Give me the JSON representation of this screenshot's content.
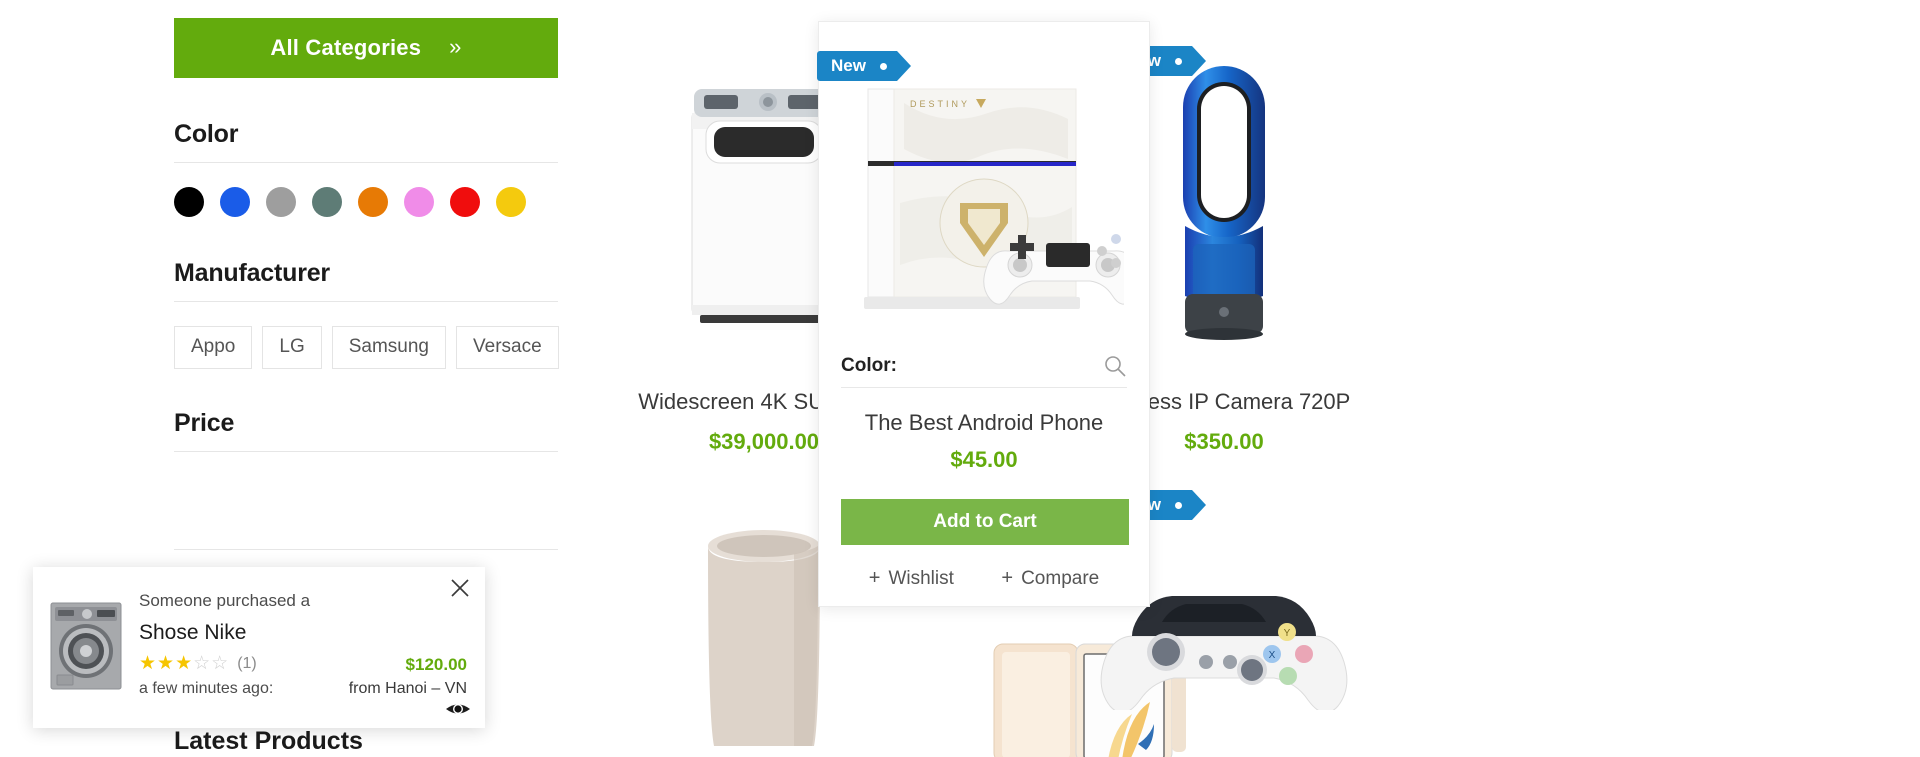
{
  "sidebar": {
    "all_categories": {
      "label": "All Categories",
      "chevron": "»",
      "bg": "#63ab0d"
    },
    "color_facet": {
      "title": "Color",
      "swatches": [
        {
          "name": "black",
          "hex": "#000000"
        },
        {
          "name": "blue",
          "hex": "#1a5ce8"
        },
        {
          "name": "grey",
          "hex": "#9e9e9e"
        },
        {
          "name": "slate",
          "hex": "#5e7c76"
        },
        {
          "name": "orange",
          "hex": "#e77a05"
        },
        {
          "name": "pink",
          "hex": "#f08ce8"
        },
        {
          "name": "red",
          "hex": "#f00d0d"
        },
        {
          "name": "yellow",
          "hex": "#f4ca0e"
        }
      ]
    },
    "manufacturer_facet": {
      "title": "Manufacturer",
      "items": [
        "Appo",
        "LG",
        "Samsung",
        "Versace"
      ]
    },
    "price_facet": {
      "title": "Price"
    },
    "latest_products_title": "Latest Products"
  },
  "products": [
    {
      "name": "Widescreen 4K SUHD TV",
      "price": "$39,000.00",
      "badge": null,
      "image": "washing-machine"
    },
    {
      "name": "The Best Android Phone",
      "price": "$45.00",
      "badge": "New",
      "image": "game-console"
    },
    {
      "name": "Wireless IP Camera 720P",
      "price": "$350.00",
      "badge": "New",
      "image": "air-purifier-fan"
    },
    {
      "name": "",
      "price": "",
      "badge": null,
      "image": "trash-can"
    },
    {
      "name": "",
      "price": "",
      "badge": null,
      "image": "smartphone-gold"
    },
    {
      "name": "",
      "price": "",
      "badge": "New",
      "image": "game-controller"
    }
  ],
  "hover_card": {
    "badge": "New",
    "color_label": "Color:",
    "search_icon": "magnifier-icon",
    "name": "The Best Android Phone",
    "price": "$45.00",
    "add_to_cart": "Add to Cart",
    "wishlist": "Wishlist",
    "compare": "Compare",
    "plus": "+",
    "accent_green": "#7ab648"
  },
  "notification": {
    "headline": "Someone purchased a",
    "product": "Shose Nike",
    "rating_filled": 3,
    "rating_total": 5,
    "review_count": "(1)",
    "time": "a few minutes ago:",
    "price": "$120.00",
    "origin": "from Hanoi – VN",
    "close_icon": "close-icon",
    "eye_icon": "eye-icon",
    "thumb": "washer-thumbnail"
  },
  "colors": {
    "green": "#63ab0d",
    "badge_blue": "#1b85c6",
    "star_gold": "#f6c500"
  }
}
